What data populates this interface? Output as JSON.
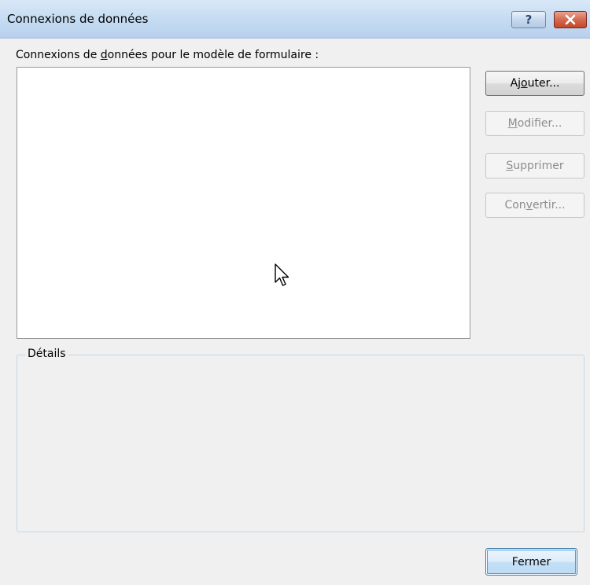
{
  "window": {
    "title": "Connexions de données",
    "help_glyph": "?",
    "close_glyph": "x"
  },
  "list": {
    "caption_before": "Connexions de ",
    "caption_mnemonic": "d",
    "caption_after": "onnées pour le modèle de formulaire :",
    "items": []
  },
  "buttons": {
    "add": {
      "before": "Aj",
      "mnemonic": "o",
      "after": "uter...",
      "enabled": true
    },
    "edit": {
      "before": "",
      "mnemonic": "M",
      "after": "odifier...",
      "enabled": false
    },
    "delete": {
      "before": "",
      "mnemonic": "S",
      "after": "upprimer",
      "enabled": false
    },
    "convert": {
      "before": "Con",
      "mnemonic": "v",
      "after": "ertir...",
      "enabled": false
    },
    "close": {
      "label": "Fermer",
      "enabled": true
    }
  },
  "details": {
    "label": "Détails"
  },
  "colors": {
    "titlebar": "#c6dcf2",
    "close_button": "#d56a50",
    "dialog_bg": "#f0f0f0"
  }
}
